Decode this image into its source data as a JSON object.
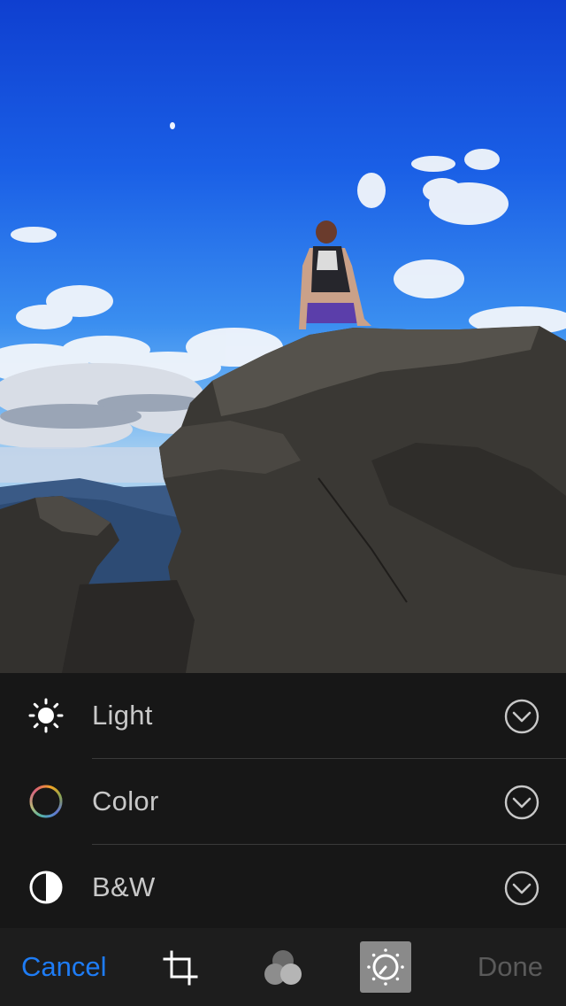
{
  "adjustments": [
    {
      "label": "Light",
      "icon": "sun-icon"
    },
    {
      "label": "Color",
      "icon": "color-wheel-icon"
    },
    {
      "label": "B&W",
      "icon": "contrast-icon"
    }
  ],
  "toolbar": {
    "cancel_label": "Cancel",
    "done_label": "Done",
    "tools": [
      "crop-icon",
      "filters-icon",
      "adjust-icon"
    ],
    "selected_tool": "adjust-icon"
  },
  "colors": {
    "accent": "#1e7cf5",
    "panel_bg": "#171717",
    "toolbar_bg": "#1d1d1d",
    "label_text": "#c8c8c8",
    "disabled_text": "#5a5a5a"
  }
}
